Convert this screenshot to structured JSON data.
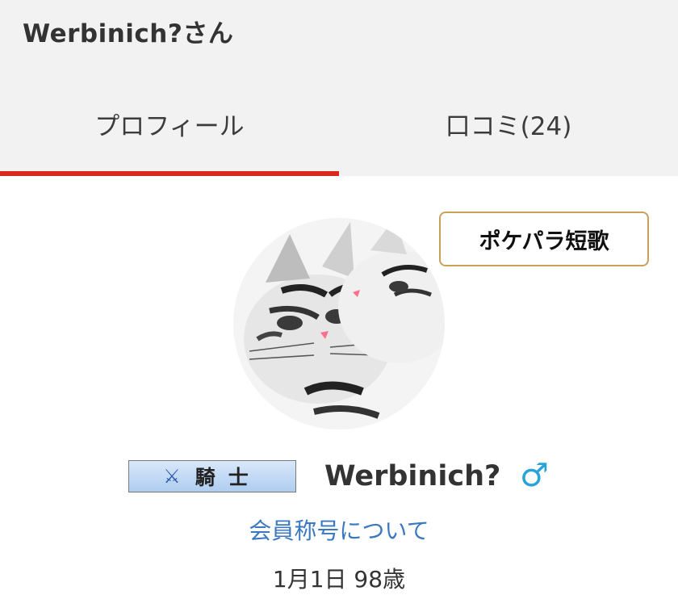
{
  "header": {
    "title": "Werbinich?さん"
  },
  "tabs": [
    {
      "label": "プロフィール",
      "active": true
    },
    {
      "label": "口コミ(24)",
      "active": false
    }
  ],
  "tanka_button": {
    "label": "ポケパラ短歌"
  },
  "profile": {
    "title_badge": {
      "icon": "crossed-axes-icon",
      "label": "騎士"
    },
    "username": "Werbinich?",
    "gender_symbol": "♂",
    "title_link": "会員称号について",
    "birthday": "1月1日 98歳"
  },
  "colors": {
    "accent": "#d9291c",
    "link": "#3a78c0",
    "gender": "#2aa3d7",
    "button_border": "#c9a15d",
    "header_bg": "#f2f2f2"
  }
}
